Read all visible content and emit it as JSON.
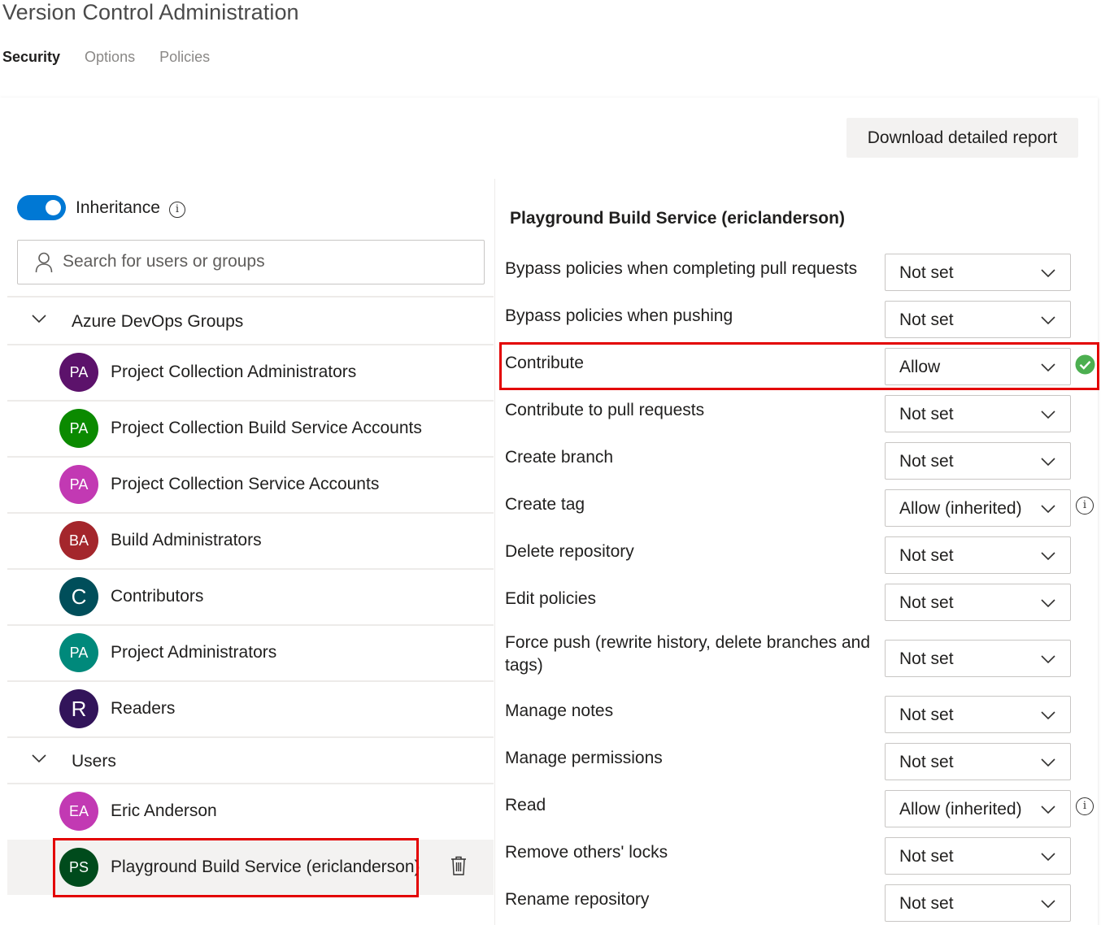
{
  "page": {
    "title": "Version Control Administration",
    "tabs": [
      {
        "label": "Security",
        "active": true
      },
      {
        "label": "Options",
        "active": false
      },
      {
        "label": "Policies",
        "active": false
      }
    ]
  },
  "toolbar": {
    "download_report_label": "Download detailed report"
  },
  "left": {
    "inheritance_label": "Inheritance",
    "inheritance_on": true,
    "search_placeholder": "Search for users or groups",
    "groups_header": "Azure DevOps Groups",
    "groups": [
      {
        "initials": "PA",
        "name": "Project Collection Administrators",
        "color": "#5c126b"
      },
      {
        "initials": "PA",
        "name": "Project Collection Build Service Accounts",
        "color": "#0b8a00"
      },
      {
        "initials": "PA",
        "name": "Project Collection Service Accounts",
        "color": "#c239b3"
      },
      {
        "initials": "BA",
        "name": "Build Administrators",
        "color": "#a4262c"
      },
      {
        "initials": "C",
        "name": "Contributors",
        "color": "#004e5a"
      },
      {
        "initials": "PA",
        "name": "Project Administrators",
        "color": "#00897b"
      },
      {
        "initials": "R",
        "name": "Readers",
        "color": "#32145a"
      }
    ],
    "users_header": "Users",
    "users": [
      {
        "initials": "EA",
        "name": "Eric Anderson",
        "color": "#c239b3"
      },
      {
        "initials": "PS",
        "name": "Playground Build Service (ericlanderson)",
        "color": "#004b1c"
      }
    ]
  },
  "right": {
    "identity_title": "Playground Build Service (ericlanderson)",
    "permissions": [
      {
        "label": "Bypass policies when completing pull requests",
        "value": "Not set",
        "status": ""
      },
      {
        "label": "Bypass policies when pushing",
        "value": "Not set",
        "status": ""
      },
      {
        "label": "Contribute",
        "value": "Allow",
        "status": "check-icon"
      },
      {
        "label": "Contribute to pull requests",
        "value": "Not set",
        "status": ""
      },
      {
        "label": "Create branch",
        "value": "Not set",
        "status": ""
      },
      {
        "label": "Create tag",
        "value": "Allow (inherited)",
        "status": "info-icon"
      },
      {
        "label": "Delete repository",
        "value": "Not set",
        "status": ""
      },
      {
        "label": "Edit policies",
        "value": "Not set",
        "status": ""
      },
      {
        "label": "Force push (rewrite history, delete branches and tags)",
        "value": "Not set",
        "status": ""
      },
      {
        "label": "Manage notes",
        "value": "Not set",
        "status": ""
      },
      {
        "label": "Manage permissions",
        "value": "Not set",
        "status": ""
      },
      {
        "label": "Read",
        "value": "Allow (inherited)",
        "status": "info-icon"
      },
      {
        "label": "Remove others' locks",
        "value": "Not set",
        "status": ""
      },
      {
        "label": "Rename repository",
        "value": "Not set",
        "status": ""
      }
    ]
  },
  "colors": {
    "accent": "#0078d4",
    "highlight": "#e30000",
    "success": "#107c10"
  }
}
